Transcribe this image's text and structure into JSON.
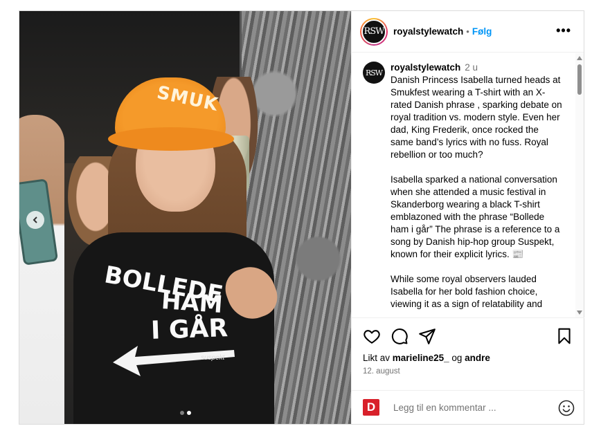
{
  "post": {
    "author": "royalstylewatch",
    "avatar_initials": "RSW",
    "separator": "•",
    "follow_label": "Følg",
    "more_label": "•••"
  },
  "media": {
    "hat_text": "SMUK",
    "shirt_line1": "BOLLEDE",
    "shirt_line2": "HAM",
    "shirt_line3": "I GÅR",
    "shirt_signature": "suspekt",
    "slide_count": 2,
    "active_slide": 2
  },
  "caption": {
    "username": "royalstylewatch",
    "time": "2 u",
    "text": "Danish Princess Isabella turned heads at Smukfest wearing a T-shirt with an X-rated Danish phrase , sparking debate on royal tradition vs. modern style. Even her dad, King Frederik, once rocked the same band’s lyrics with no fuss. Royal rebellion or too much?\n\nIsabella sparked a national conversation when she attended a  music festival in Skanderborg wearing a black T-shirt emblazoned with the phrase “Bollede ham i går” The phrase is a reference to a song by Danish hip-hop group Suspekt, known for their explicit lyrics. 📰\n\nWhile some royal observers lauded Isabella for her bold fashion choice, viewing it as a sign of relatability and"
  },
  "actions": {
    "liked_by_prefix": "Likt av",
    "liked_by_user": "marieline25_",
    "liked_by_conj": "og",
    "liked_by_others": "andre",
    "date": "12. august"
  },
  "comment_box": {
    "logo_letter": "D",
    "placeholder": "Legg til en kommentar ..."
  },
  "colors": {
    "link_blue": "#0095f6",
    "muted": "#737373",
    "border": "#dbdbdb",
    "logo_red": "#d8202a"
  }
}
